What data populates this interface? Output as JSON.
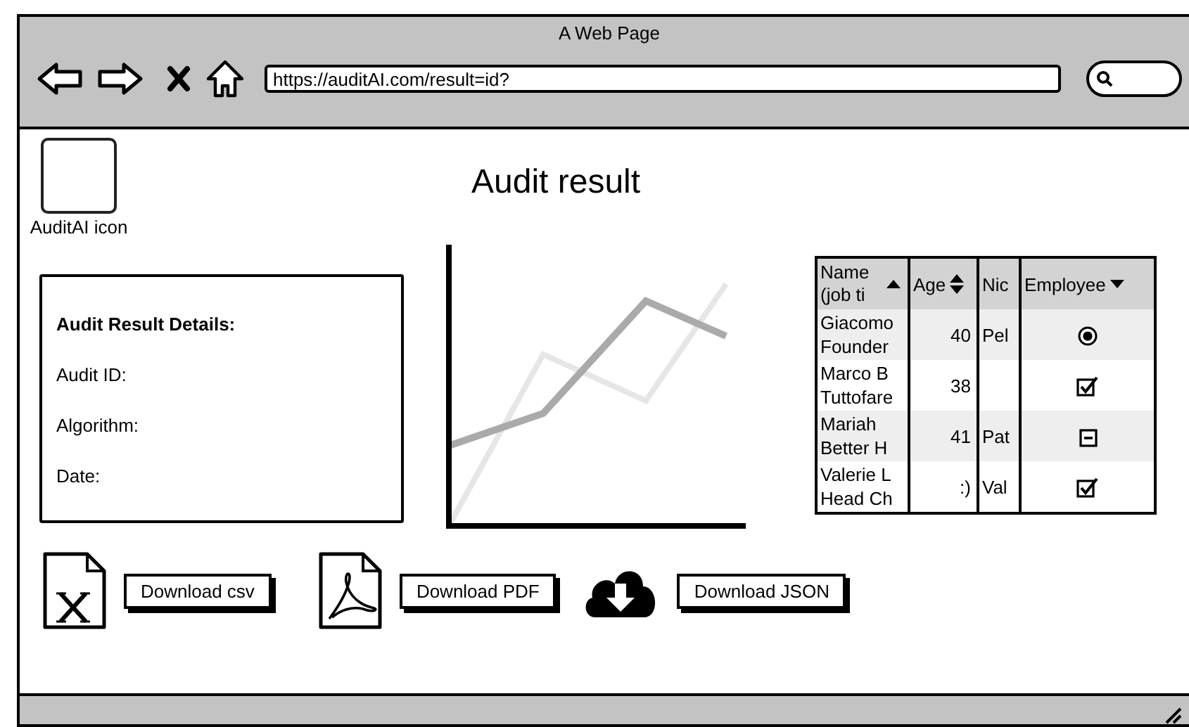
{
  "window": {
    "title": "A Web Page",
    "url": "https://auditAI.com/result=id?"
  },
  "header": {
    "logo_label": "AuditAI icon",
    "title": "Audit result"
  },
  "details": {
    "heading": "Audit Result Details:",
    "fields": [
      "Audit ID:",
      "Algorithm:",
      "Date:"
    ]
  },
  "table": {
    "columns": [
      {
        "label": "Name (job ti",
        "sort_up": true,
        "sort_down": false
      },
      {
        "label": "Age",
        "sort_up": true,
        "sort_down": true
      },
      {
        "label": "Nic",
        "sort_up": false,
        "sort_down": false
      },
      {
        "label": "Employee",
        "sort_up": false,
        "sort_down": true
      }
    ],
    "rows": [
      {
        "name": "Giacomo",
        "job": "Founder",
        "age": "40",
        "nic": "Pel",
        "employee": {
          "kind": "radio",
          "checked": true
        }
      },
      {
        "name": "Marco B",
        "job": "Tuttofare",
        "age": "38",
        "employee": {
          "kind": "checkbox",
          "checked": true
        }
      },
      {
        "name": "Mariah",
        "job": "Better H",
        "age": "41",
        "nic": "Pat",
        "employee": {
          "kind": "indeterminate",
          "checked": true
        }
      },
      {
        "name": "Valerie L",
        "job": "Head Ch",
        "age": ":)",
        "nic": "Val",
        "employee": {
          "kind": "checkbox",
          "checked": true
        }
      }
    ]
  },
  "downloads": [
    {
      "kind": "spreadsheet",
      "label": "Download csv"
    },
    {
      "kind": "pdf",
      "label": "Download PDF"
    },
    {
      "kind": "cloud",
      "label": "Download JSON"
    }
  ]
}
